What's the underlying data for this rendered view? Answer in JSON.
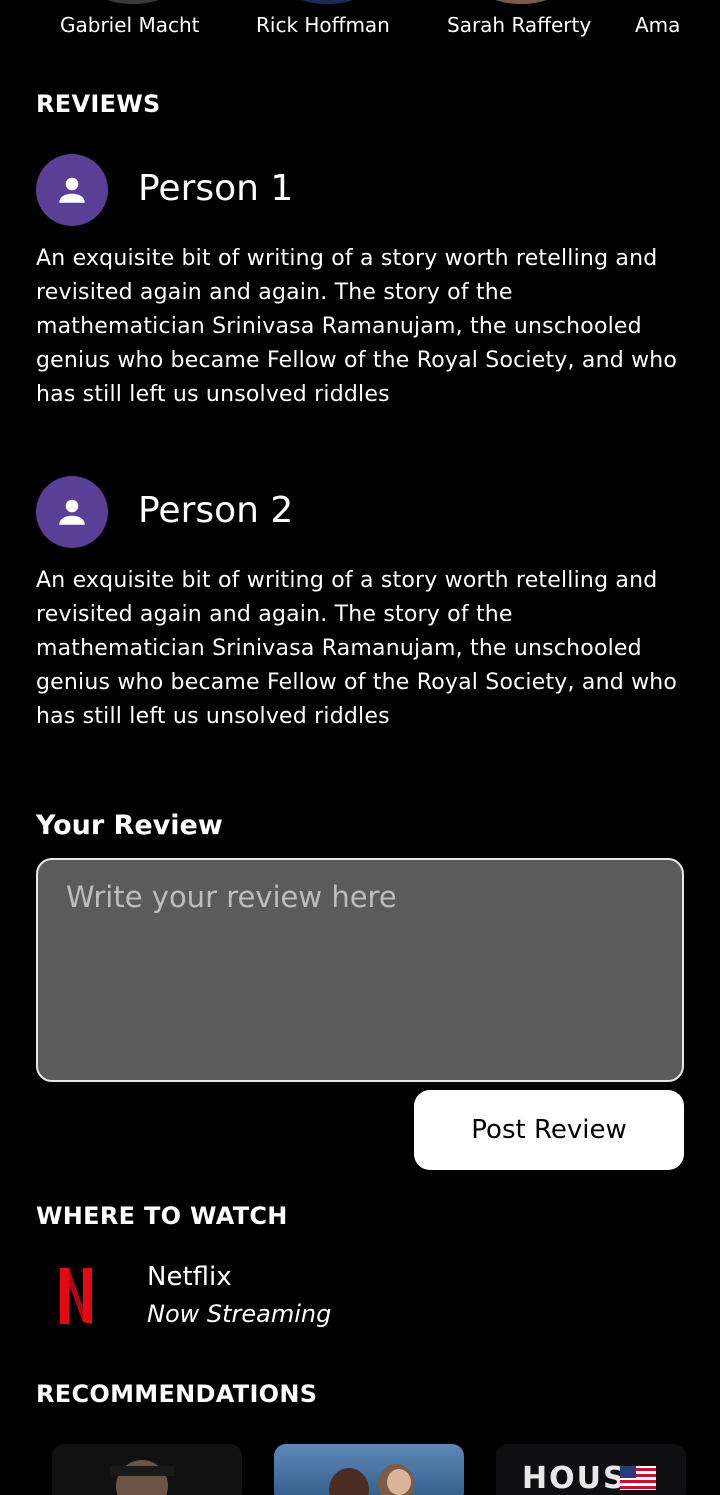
{
  "cast": [
    {
      "name": "Gabriel Macht"
    },
    {
      "name": "Rick Hoffman"
    },
    {
      "name": "Sarah Rafferty"
    },
    {
      "name": "Ama"
    }
  ],
  "reviews_section": {
    "title": "REVIEWS",
    "items": [
      {
        "author": "Person 1",
        "text": "An exquisite bit of writing of a story worth retelling and revisited again and again. The story of the mathematician Srinivasa Ramanujam, the unschooled genius who became Fellow of the Royal Society, and who has still left us unsolved riddles"
      },
      {
        "author": "Person 2",
        "text": "An exquisite bit of writing of a story worth retelling and revisited again and again. The story of the mathematician Srinivasa Ramanujam, the unschooled genius who became Fellow of the Royal Society, and who has still left us unsolved riddles"
      }
    ]
  },
  "your_review": {
    "label": "Your Review",
    "value": "",
    "placeholder": "Write your review here",
    "submit_label": "Post Review"
  },
  "where_to_watch": {
    "title": "WHERE TO WATCH",
    "provider": {
      "name": "Netflix",
      "status": "Now Streaming",
      "logo_icon": "netflix-logo-icon",
      "logo_color": "#e50914"
    }
  },
  "recommendations": {
    "title": "RECOMMENDATIONS",
    "items": [
      {
        "poster_icon": "poster-image"
      },
      {
        "poster_icon": "poster-image"
      },
      {
        "poster_icon": "poster-image",
        "poster_text": "HOUSE"
      }
    ]
  },
  "colors": {
    "background": "#000000",
    "avatar": "#5a3f96",
    "input_bg": "#5b5b5b"
  }
}
